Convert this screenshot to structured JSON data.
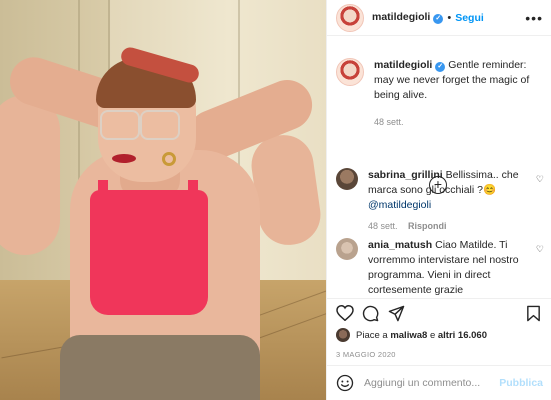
{
  "post": {
    "author": "matildegioli",
    "follow_label": "Segui",
    "separator": "•",
    "more_label": "•••"
  },
  "caption": {
    "username": "matildegioli",
    "text": "Gentle reminder: may we never forget the magic of being alive.",
    "time": "48 sett."
  },
  "comments": [
    {
      "username": "sabrina_grillini",
      "text": "Bellissima.. che marca sono gli occhiali ?",
      "emoji": "😊",
      "mention": "@matildegioli",
      "time": "48 sett.",
      "reply_label": "Rispondi"
    },
    {
      "username": "ania_matush",
      "text": "Ciao Matilde. Ti vorremmo intervistare nel nostro programma. Vieni in direct cortesemente grazie"
    }
  ],
  "likes": {
    "prefix": "Piace a",
    "user": "maliwa8",
    "middle": "e",
    "others": "altri 16.060"
  },
  "date": "3 MAGGIO 2020",
  "add_comment": {
    "placeholder": "Aggiungi un commento...",
    "publish_label": "Pubblica"
  },
  "colors": {
    "accent": "#0095f6",
    "verified": "#3897f0",
    "publish_disabled": "#b2dffc",
    "muted": "#8e8e8e"
  },
  "icons": [
    "verified-badge-icon",
    "more-options-icon",
    "heart-icon",
    "comment-icon",
    "share-icon",
    "bookmark-icon",
    "plus-circle-icon",
    "emoji-icon"
  ]
}
